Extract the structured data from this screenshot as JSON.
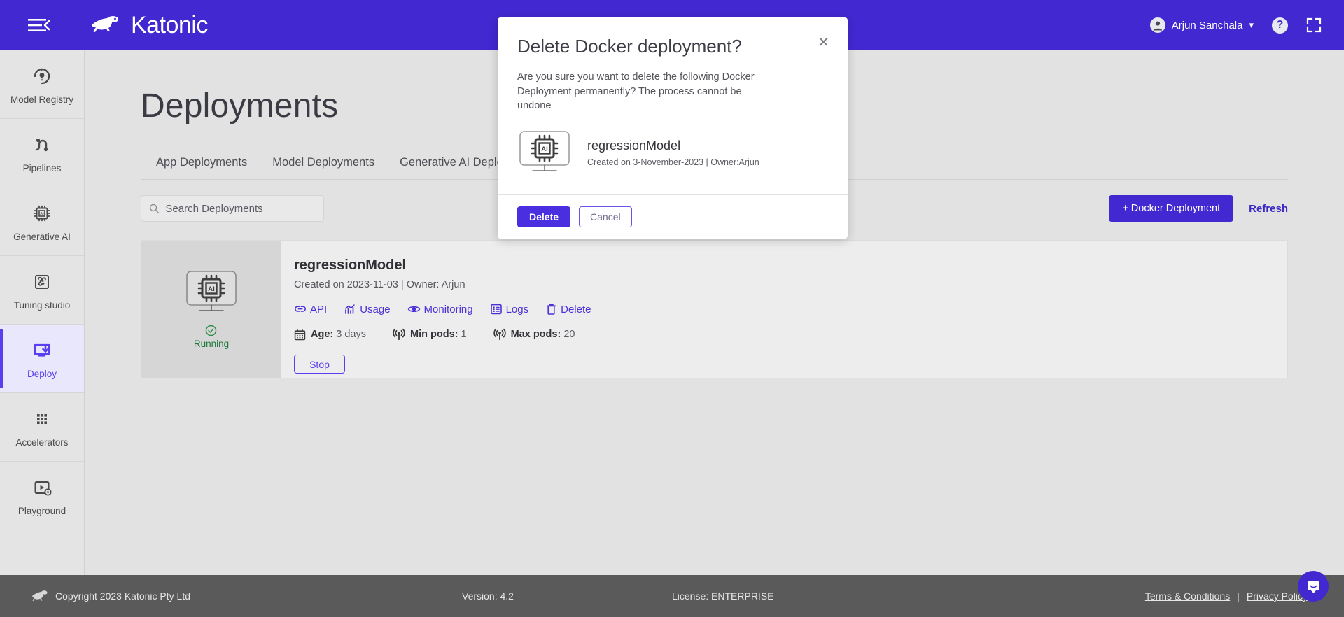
{
  "topbar": {
    "menu_icon": "hamburger-icon",
    "brand": "Katonic",
    "user_name": "Arjun Sanchala",
    "user_icon": "account-icon",
    "chevron_icon": "chevron-down-icon",
    "help_icon": "help-icon",
    "help_label": "?",
    "fullscreen_icon": "fullscreen-icon",
    "brand_color": "#4128d1"
  },
  "sidebar": {
    "items": [
      {
        "label": "Model Registry",
        "icon": "model-registry-icon",
        "active": false
      },
      {
        "label": "Pipelines",
        "icon": "pipelines-icon",
        "active": false
      },
      {
        "label": "Generative AI",
        "icon": "generative-ai-icon",
        "active": false
      },
      {
        "label": "Tuning studio",
        "icon": "tuning-studio-icon",
        "active": false
      },
      {
        "label": "Deploy",
        "icon": "deploy-icon",
        "active": true
      },
      {
        "label": "Accelerators",
        "icon": "accelerators-icon",
        "active": false
      },
      {
        "label": "Playground",
        "icon": "playground-icon",
        "active": false
      }
    ],
    "active_color": "#5b3ef0"
  },
  "main": {
    "page_title": "Deployments",
    "tabs": [
      {
        "label": "App Deployments"
      },
      {
        "label": "Model Deployments"
      },
      {
        "label": "Generative AI Deployments"
      }
    ],
    "search": {
      "placeholder": "Search Deployments",
      "value": "",
      "icon": "search-icon"
    },
    "create_button": "+ Docker Deployment",
    "refresh_link": "Refresh",
    "deployments": [
      {
        "name": "regressionModel",
        "subtitle": "Created on 2023-11-03 | Owner: Arjun",
        "thumb_icon": "ai-chip-monitor-icon",
        "status": "Running",
        "status_icon": "check-circle-icon",
        "status_color": "#1f7a3d",
        "actions": [
          {
            "label": "API",
            "icon": "link-icon"
          },
          {
            "label": "Usage",
            "icon": "chart-icon"
          },
          {
            "label": "Monitoring",
            "icon": "eye-icon"
          },
          {
            "label": "Logs",
            "icon": "list-icon"
          },
          {
            "label": "Delete",
            "icon": "trash-icon"
          }
        ],
        "meta": [
          {
            "icon": "calendar-icon",
            "label": "Age:",
            "value": "3 days"
          },
          {
            "icon": "pods-icon",
            "label": "Min pods:",
            "value": "1"
          },
          {
            "icon": "pods-icon",
            "label": "Max pods:",
            "value": "20"
          }
        ],
        "stop_button": "Stop"
      }
    ]
  },
  "modal": {
    "title": "Delete Docker deployment?",
    "close_icon": "close-icon",
    "description": "Are you sure you want to delete the following Docker Deployment permanently? The process cannot be undone",
    "item": {
      "icon": "ai-chip-monitor-icon",
      "name": "regressionModel",
      "meta": "Created on 3-November-2023 | Owner:Arjun"
    },
    "delete_button": "Delete",
    "cancel_button": "Cancel"
  },
  "footer": {
    "logo_icon": "kangaroo-logo-icon",
    "copyright": "Copyright 2023 Katonic Pty Ltd",
    "version": "Version: 4.2",
    "license": "License: ENTERPRISE",
    "terms_link": "Terms & Conditions",
    "separator": "|",
    "privacy_link": "Privacy Policy"
  },
  "chat": {
    "icon": "chat-bubble-icon"
  }
}
